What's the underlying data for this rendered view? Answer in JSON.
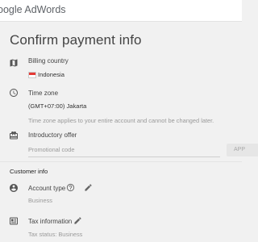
{
  "header": {
    "brand": "oogle AdWords"
  },
  "page": {
    "title": "Confirm payment info"
  },
  "billing": {
    "label": "Billing country",
    "value": "Indonesia",
    "flag_colors": [
      "#e53935",
      "#ffffff"
    ]
  },
  "timezone": {
    "label": "Time zone",
    "value": "(GMT+07:00) Jakarta",
    "note": "Time zone applies to your entire account and cannot be changed later."
  },
  "offer": {
    "label": "Introductory offer",
    "placeholder": "Promotional code",
    "apply_label": "APP"
  },
  "customer_info": {
    "heading": "Customer info",
    "account_type": {
      "label": "Account type",
      "value": "Business"
    },
    "tax": {
      "label": "Tax information",
      "value": "Tax status: Business"
    }
  },
  "icons": {
    "map": "map-icon",
    "clock": "clock-icon",
    "gift": "gift-card-icon",
    "person": "person-icon",
    "help": "help-icon",
    "edit": "edit-pencil-icon",
    "id": "id-card-icon"
  }
}
